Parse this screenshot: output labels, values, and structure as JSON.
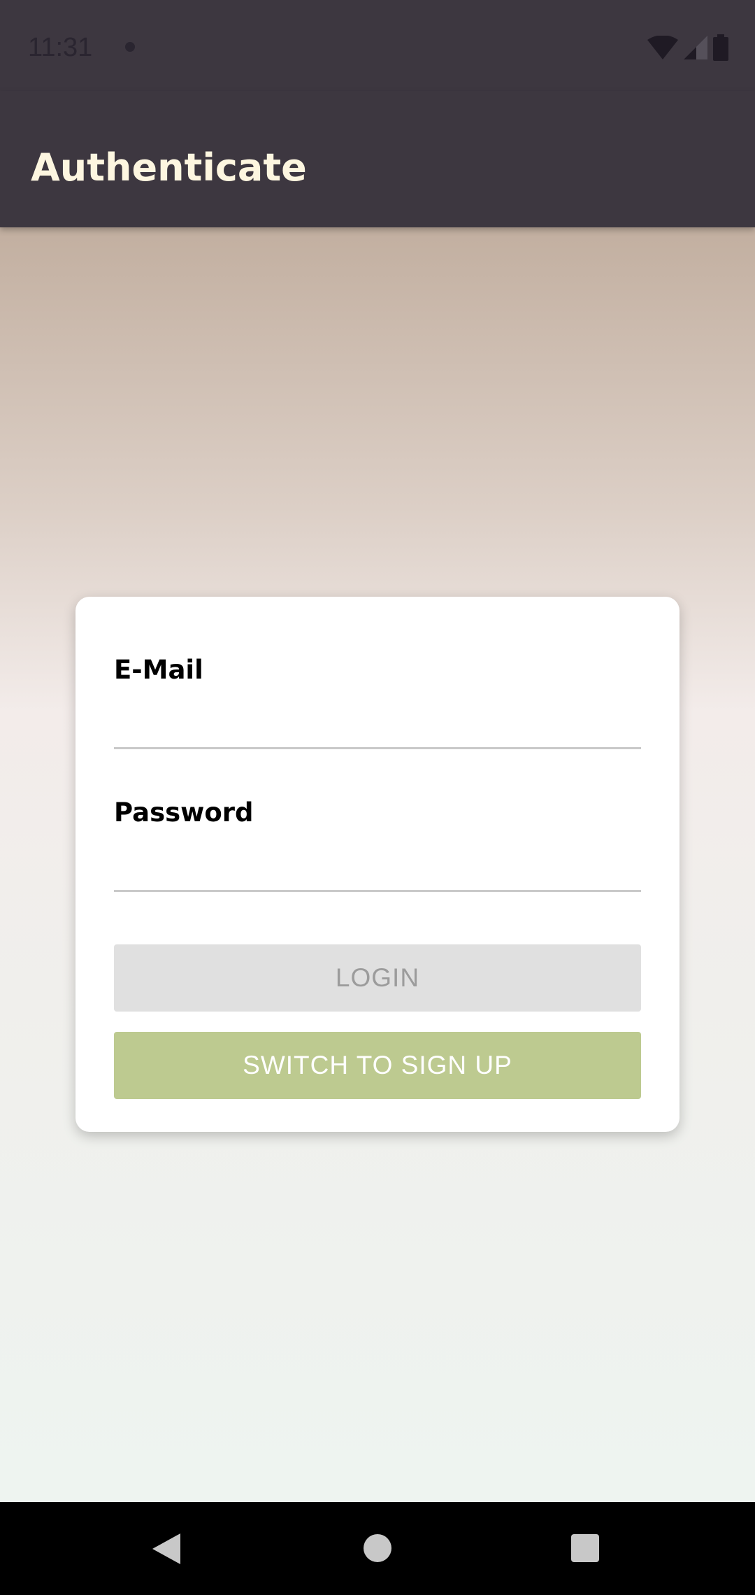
{
  "status_bar": {
    "time": "11:31"
  },
  "app_bar": {
    "title": "Authenticate"
  },
  "form": {
    "email": {
      "label": "E-Mail",
      "value": ""
    },
    "password": {
      "label": "Password",
      "value": ""
    },
    "login_button": "LOGIN",
    "switch_button": "SWITCH TO SIGN UP"
  },
  "colors": {
    "app_bar": "#3d3740",
    "title": "#fdf6e0",
    "switch_button": "#bdca90",
    "login_button_disabled": "#e0e0e0"
  },
  "icons": {
    "status": [
      "wifi-icon",
      "cellular-signal-icon",
      "battery-icon"
    ],
    "navigation": [
      "back-icon",
      "home-icon",
      "recents-icon"
    ]
  }
}
